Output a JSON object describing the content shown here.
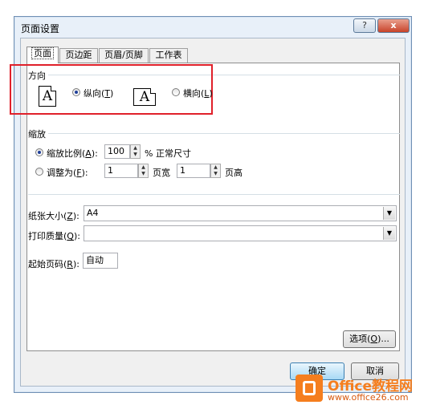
{
  "window": {
    "title": "页面设置",
    "help_icon": "?",
    "close_icon": "x"
  },
  "tabs": [
    {
      "label": "页面",
      "active": true
    },
    {
      "label": "页边距",
      "active": false
    },
    {
      "label": "页眉/页脚",
      "active": false
    },
    {
      "label": "工作表",
      "active": false
    }
  ],
  "orientation": {
    "section_label": "方向",
    "portrait_icon_glyph": "A",
    "landscape_icon_glyph": "A",
    "portrait_label": "纵向",
    "portrait_key": "T",
    "landscape_label": "横向",
    "landscape_key": "L",
    "selected": "portrait",
    "highlight_color": "#e0202a"
  },
  "scaling": {
    "section_label": "缩放",
    "adjust_label": "缩放比例",
    "adjust_key": "A",
    "adjust_value": "100",
    "adjust_suffix": "% 正常尺寸",
    "fit_label": "调整为",
    "fit_key": "F",
    "fit_wide_value": "1",
    "fit_wide_suffix": "页宽",
    "fit_tall_value": "1",
    "fit_tall_suffix": "页高",
    "selected": "adjust"
  },
  "paper": {
    "size_label": "纸张大小",
    "size_key": "Z",
    "size_value": "A4",
    "quality_label": "打印质量",
    "quality_key": "Q",
    "quality_value": "",
    "first_page_label": "起始页码",
    "first_page_key": "R",
    "first_page_value": "自动"
  },
  "buttons": {
    "options_label": "选项",
    "options_key": "O",
    "ok_label": "确定",
    "cancel_label": "取消"
  },
  "watermark": {
    "brand_prefix": "Office",
    "brand_suffix": "教程网",
    "url": "www.office26.com",
    "color": "#f57e1e"
  }
}
